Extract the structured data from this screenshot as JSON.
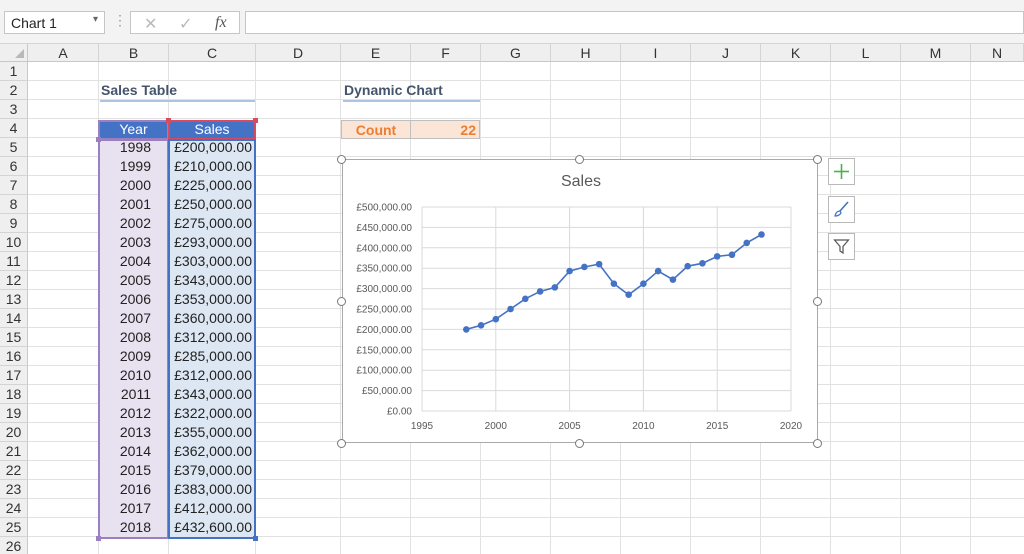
{
  "formula_bar": {
    "name_box": "Chart 1",
    "name_box_arrow": "▾",
    "dots": "⋮",
    "cancel": "✕",
    "enter": "✓",
    "fx": "fx",
    "formula": ""
  },
  "columns": [
    "A",
    "B",
    "C",
    "D",
    "E",
    "F",
    "G",
    "H",
    "I",
    "J",
    "K",
    "L",
    "M",
    "N"
  ],
  "rows": [
    "1",
    "2",
    "3",
    "4",
    "5",
    "6",
    "7",
    "8",
    "9",
    "10",
    "11",
    "12",
    "13",
    "14",
    "15",
    "16",
    "17",
    "18",
    "19",
    "20",
    "21",
    "22",
    "23",
    "24",
    "25",
    "26"
  ],
  "sales_table": {
    "title": "Sales Table",
    "year_header": "Year",
    "sales_header": "Sales",
    "rows": [
      {
        "year": "1998",
        "sales": "£200,000.00"
      },
      {
        "year": "1999",
        "sales": "£210,000.00"
      },
      {
        "year": "2000",
        "sales": "£225,000.00"
      },
      {
        "year": "2001",
        "sales": "£250,000.00"
      },
      {
        "year": "2002",
        "sales": "£275,000.00"
      },
      {
        "year": "2003",
        "sales": "£293,000.00"
      },
      {
        "year": "2004",
        "sales": "£303,000.00"
      },
      {
        "year": "2005",
        "sales": "£343,000.00"
      },
      {
        "year": "2006",
        "sales": "£353,000.00"
      },
      {
        "year": "2007",
        "sales": "£360,000.00"
      },
      {
        "year": "2008",
        "sales": "£312,000.00"
      },
      {
        "year": "2009",
        "sales": "£285,000.00"
      },
      {
        "year": "2010",
        "sales": "£312,000.00"
      },
      {
        "year": "2011",
        "sales": "£343,000.00"
      },
      {
        "year": "2012",
        "sales": "£322,000.00"
      },
      {
        "year": "2013",
        "sales": "£355,000.00"
      },
      {
        "year": "2014",
        "sales": "£362,000.00"
      },
      {
        "year": "2015",
        "sales": "£379,000.00"
      },
      {
        "year": "2016",
        "sales": "£383,000.00"
      },
      {
        "year": "2017",
        "sales": "£412,000.00"
      },
      {
        "year": "2018",
        "sales": "£432,600.00"
      }
    ]
  },
  "dynamic_chart": {
    "title": "Dynamic Chart",
    "count_label": "Count",
    "count_value": "22"
  },
  "chart_side_buttons": [
    "chart-elements",
    "chart-styles",
    "chart-filters"
  ],
  "colors": {
    "header_blue": "#4472c4",
    "count_orange": "#ed7d31",
    "series_line": "#4472c4"
  },
  "chart_data": {
    "type": "scatter",
    "title": "Sales",
    "xlabel": "",
    "ylabel": "",
    "xlim": [
      1995,
      2020
    ],
    "ylim": [
      0,
      500000
    ],
    "x_ticks": [
      "1995",
      "2000",
      "2005",
      "2010",
      "2015",
      "2020"
    ],
    "y_ticks": [
      "£0.00",
      "£50,000.00",
      "£100,000.00",
      "£150,000.00",
      "£200,000.00",
      "£250,000.00",
      "£300,000.00",
      "£350,000.00",
      "£400,000.00",
      "£450,000.00",
      "£500,000.00"
    ],
    "grid": true,
    "legend": "none",
    "series": [
      {
        "x": [
          1998,
          1999,
          2000,
          2001,
          2002,
          2003,
          2004,
          2005,
          2006,
          2007,
          2008,
          2009,
          2010,
          2011,
          2012,
          2013,
          2014,
          2015,
          2016,
          2017,
          2018
        ],
        "y": [
          200000,
          210000,
          225000,
          250000,
          275000,
          293000,
          303000,
          343000,
          353000,
          360000,
          312000,
          285000,
          312000,
          343000,
          322000,
          355000,
          362000,
          379000,
          383000,
          412000,
          432600
        ]
      }
    ]
  }
}
